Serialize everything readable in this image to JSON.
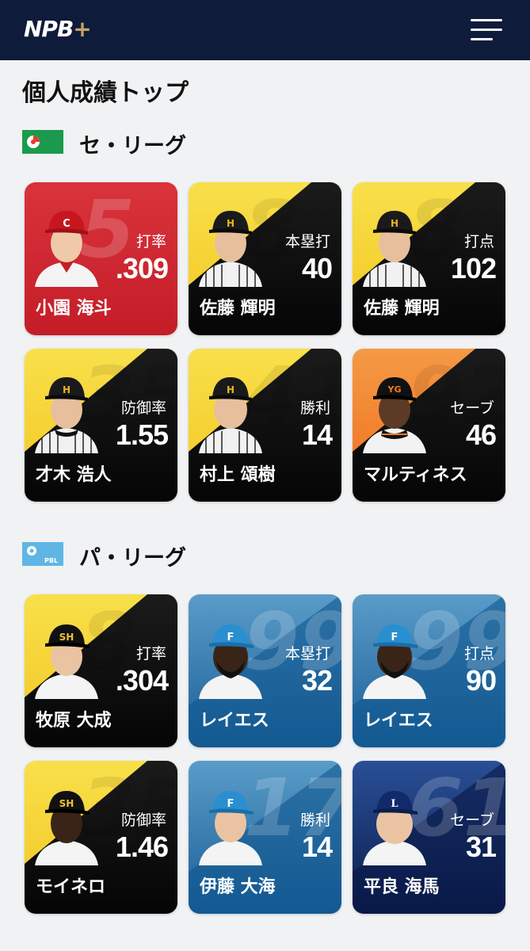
{
  "header": {
    "logo_text": "NPB",
    "logo_plus": "+"
  },
  "page_title": "個人成績トップ",
  "central": {
    "name": "セ・リーグ",
    "cards": [
      {
        "category": "打率",
        "value": ".309",
        "player": "小園 海斗",
        "number": "5"
      },
      {
        "category": "本塁打",
        "value": "40",
        "player": "佐藤 輝明",
        "number": "8"
      },
      {
        "category": "打点",
        "value": "102",
        "player": "佐藤 輝明",
        "number": "8"
      },
      {
        "category": "防御率",
        "value": "1.55",
        "player": "才木 浩人",
        "number": "35"
      },
      {
        "category": "勝利",
        "value": "14",
        "player": "村上 頌樹",
        "number": "41"
      },
      {
        "category": "セーブ",
        "value": "46",
        "player": "マルティネス",
        "number": "92"
      }
    ]
  },
  "pacific": {
    "name": "パ・リーグ",
    "icon_text": "PBL",
    "cards": [
      {
        "category": "打率",
        "value": ".304",
        "player": "牧原 大成",
        "number": "8"
      },
      {
        "category": "本塁打",
        "value": "32",
        "player": "レイエス",
        "number": "99"
      },
      {
        "category": "打点",
        "value": "90",
        "player": "レイエス",
        "number": "99"
      },
      {
        "category": "防御率",
        "value": "1.46",
        "player": "モイネロ",
        "number": "35"
      },
      {
        "category": "勝利",
        "value": "14",
        "player": "伊藤 大海",
        "number": "17"
      },
      {
        "category": "セーブ",
        "value": "31",
        "player": "平良 海馬",
        "number": "61"
      }
    ]
  },
  "colors": {
    "header_bg": "#0f1b3a",
    "carp_red": "#d0232e",
    "tigers_yellow": "#f7d633",
    "giants_orange": "#f07a22",
    "hawks_yellow": "#f7d633",
    "fighters_blue": "#1f6ea8",
    "lions_navy": "#0d2a66",
    "central_icon_green": "#1b9a4e",
    "pacific_icon_blue": "#5fb6e4"
  }
}
